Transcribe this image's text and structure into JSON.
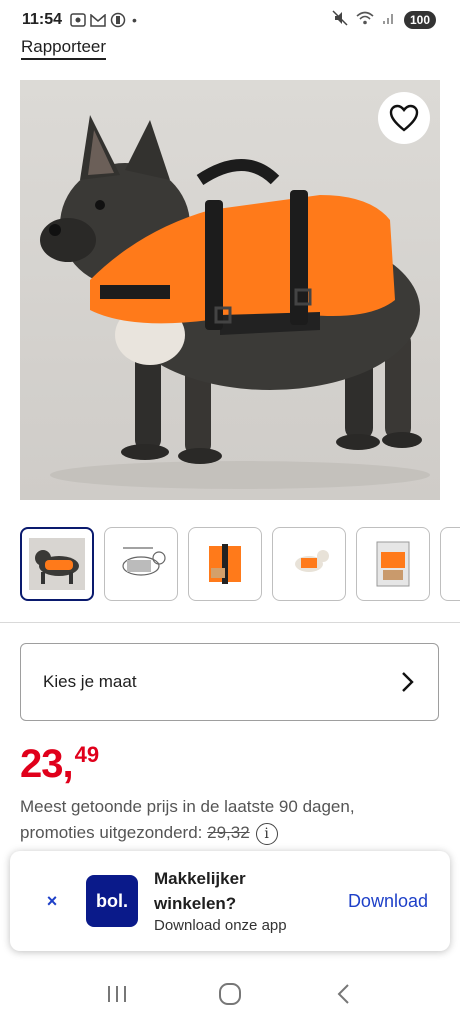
{
  "status_bar": {
    "time": "11:54",
    "battery": "100",
    "dot": "•"
  },
  "report_link": "Rapporteer",
  "product": {
    "size_select_label": "Kies je maat",
    "price_main": "23,",
    "price_cents": "49",
    "price_note_line1": "Meest getoonde prijs in de laatste 90 dagen,",
    "price_note_line2": "promoties uitgezonderd: ",
    "old_price": "29,32"
  },
  "app_banner": {
    "close": "×",
    "logo_text": "bol.",
    "title": "Makkelijker winkelen?",
    "subtitle": "Download onze app",
    "download": "Download"
  },
  "colors": {
    "price_red": "#e0001b",
    "brand_blue": "#0a1a8a",
    "link_blue": "#1e40c8",
    "vest_orange": "#ff7a1a"
  }
}
